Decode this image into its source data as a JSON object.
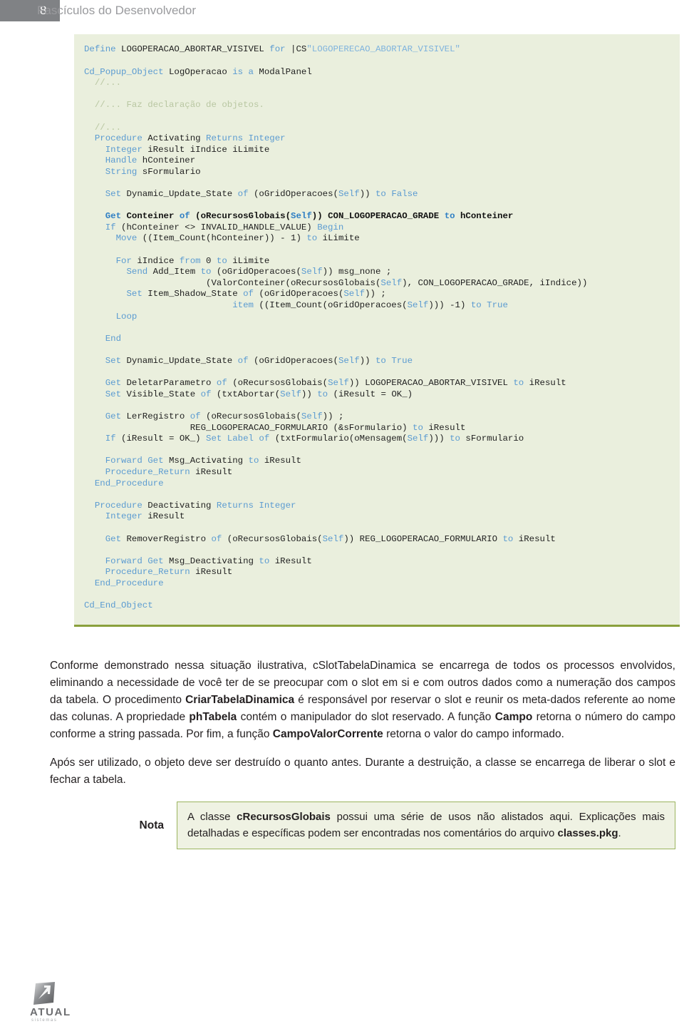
{
  "header": {
    "page_number": "8",
    "title": "Fascículos do Desenvolvedor",
    "page_number_bg": "#808285",
    "title_color": "#9a9b9e"
  },
  "code_block": {
    "background": "#eaefdd",
    "bottom_border_color": "#8aa03c",
    "keyword_color": "#5b9bd1",
    "comment_color": "#b9c7a2",
    "string_color": "#7fb3dd",
    "lines": [
      "Define LOGOPERACAO_ABORTAR_VISIVEL for |CS\"LOGOPERECAO_ABORTAR_VISIVEL\"",
      "",
      "Cd_Popup_Object LogOperacao is a ModalPanel",
      "  //...",
      "",
      "  //... Faz declaração de objetos.",
      "",
      "  //...",
      "  Procedure Activating Returns Integer",
      "    Integer iResult iIndice iLimite",
      "    Handle hConteiner",
      "    String sFormulario",
      "",
      "    Set Dynamic_Update_State of (oGridOperacoes(Self)) to False",
      "",
      "    Get Conteiner of (oRecursosGlobais(Self)) CON_LOGOPERACAO_GRADE to hConteiner",
      "    If (hConteiner <> INVALID_HANDLE_VALUE) Begin",
      "      Move ((Item_Count(hConteiner)) - 1) to iLimite",
      "",
      "      For iIndice from 0 to iLimite",
      "        Send Add_Item to (oGridOperacoes(Self)) msg_none ;",
      "                       (ValorConteiner(oRecursosGlobais(Self), CON_LOGOPERACAO_GRADE, iIndice))",
      "        Set Item_Shadow_State of (oGridOperacoes(Self)) ;",
      "                            item ((Item_Count(oGridOperacoes(Self))) -1) to True",
      "      Loop",
      "",
      "    End",
      "",
      "    Set Dynamic_Update_State of (oGridOperacoes(Self)) to True",
      "",
      "    Get DeletarParametro of (oRecursosGlobais(Self)) LOGOPERACAO_ABORTAR_VISIVEL to iResult",
      "    Set Visible_State of (txtAbortar(Self)) to (iResult = OK_)",
      "",
      "    Get LerRegistro of (oRecursosGlobais(Self)) ;",
      "                    REG_LOGOPERACAO_FORMULARIO (&sFormulario) to iResult",
      "    If (iResult = OK_) Set Label of (txtFormulario(oMensagem(Self))) to sFormulario",
      "",
      "    Forward Get Msg_Activating to iResult",
      "    Procedure_Return iResult",
      "  End_Procedure",
      "",
      "  Procedure Deactivating Returns Integer",
      "    Integer iResult",
      "",
      "    Get RemoverRegistro of (oRecursosGlobais(Self)) REG_LOGOPERACAO_FORMULARIO to iResult",
      "",
      "    Forward Get Msg_Deactivating to iResult",
      "    Procedure_Return iResult",
      "  End_Procedure",
      "",
      "Cd_End_Object"
    ]
  },
  "paragraphs": {
    "p1_part1": "Conforme demonstrado nessa situação ilustrativa, cSlotTabelaDinamica se encarrega de todos os processos envolvidos, eliminando a necessidade de você ter de se preocupar com o slot em si e com outros dados como a numeração dos campos da tabela. O procedimento ",
    "p1_bold1": "CriarTabelaDinamica",
    "p1_part2": " é responsável por reservar o slot e reunir os meta-dados referente ao nome das colunas. A propriedade ",
    "p1_bold2": "phTabela",
    "p1_part3": " contém o manipulador do slot reservado. A função ",
    "p1_bold3": "Campo",
    "p1_part4": " retorna o número do campo conforme a string passada. Por fim, a função ",
    "p1_bold4": "CampoValorCorrente",
    "p1_part5": " retorna o valor do campo informado.",
    "p2": "Após ser utilizado, o objeto deve ser destruído o quanto antes. Durante a destruição, a classe se encarrega de liberar o slot e fechar a tabela."
  },
  "nota": {
    "label": "Nota",
    "part1": "A classe ",
    "bold1": "cRecursosGlobais",
    "part2": " possui uma série de usos não alistados aqui. Explicações mais detalhadas e específicas podem ser encontradas nos comentários do arquivo ",
    "bold2": "classes.pkg",
    "part3": ".",
    "border_color": "#9bb45e",
    "background": "#eff2e3"
  },
  "footer": {
    "logo_name": "ATUAL",
    "logo_tagline": "sistemas",
    "logo_color": "#6d6e71"
  }
}
